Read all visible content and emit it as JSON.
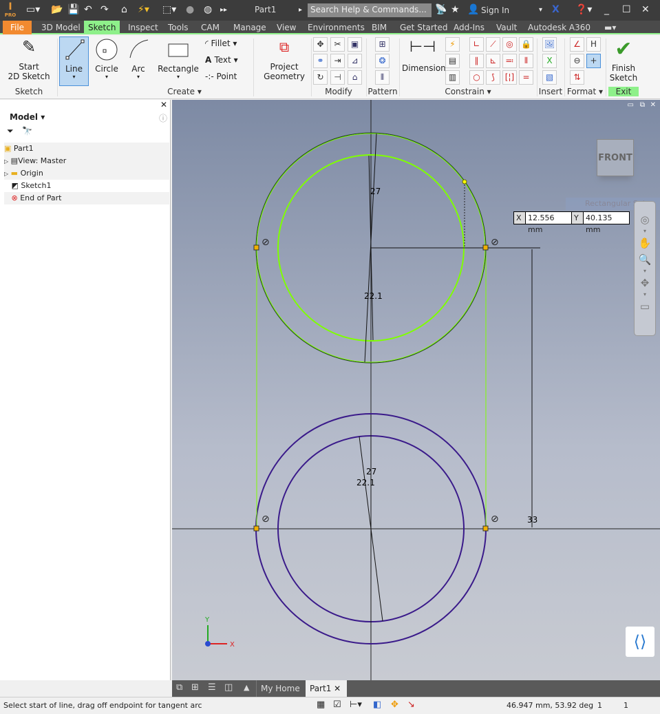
{
  "title_bar": {
    "doc_title": "Part1",
    "search_placeholder": "Search Help & Commands...",
    "sign_in": "Sign In",
    "app_badge": "PRO"
  },
  "menu": {
    "tabs": [
      "File",
      "3D Model",
      "Sketch",
      "Inspect",
      "Tools",
      "CAM",
      "Manage",
      "View",
      "Environments",
      "BIM",
      "Get Started",
      "Add-Ins",
      "Vault",
      "Autodesk A360"
    ],
    "active": "Sketch"
  },
  "ribbon": {
    "sketch": {
      "start_line1": "Start",
      "start_line2": "2D Sketch",
      "group": "Sketch"
    },
    "create": {
      "line": "Line",
      "circle": "Circle",
      "arc": "Arc",
      "rectangle": "Rectangle",
      "fillet": "Fillet",
      "text": "Text",
      "point": "Point",
      "project_line1": "Project",
      "project_line2": "Geometry",
      "group": "Create"
    },
    "modify": {
      "group": "Modify"
    },
    "pattern": {
      "group": "Pattern"
    },
    "constrain": {
      "dimension": "Dimension",
      "group": "Constrain"
    },
    "insert": {
      "group": "Insert"
    },
    "format": {
      "group": "Format"
    },
    "exit": {
      "finish_line1": "Finish",
      "finish_line2": "Sketch",
      "group": "Exit"
    },
    "accent": "#8ef08a"
  },
  "browser": {
    "title": "Model",
    "items": [
      {
        "label": "Part1",
        "icon": "part-icon"
      },
      {
        "label": "View: Master",
        "icon": "view-icon"
      },
      {
        "label": "Origin",
        "icon": "folder-icon"
      },
      {
        "label": "Sketch1",
        "icon": "sketch-icon"
      },
      {
        "label": "End of Part",
        "icon": "end-of-part-icon"
      }
    ]
  },
  "viewport": {
    "viewcube": "FRONT",
    "snip_label": "Rectangular Snip",
    "coord": {
      "x_label": "X",
      "x_value": "12.556 mm",
      "y_label": "Y",
      "y_value": "40.135 mm"
    },
    "dimensions": {
      "outer_top": "27",
      "inner_top": "22.1",
      "outer_bottom": "27",
      "inner_bottom": "22.1",
      "distance": "33"
    },
    "axis": {
      "x": "X",
      "y": "Y"
    },
    "colors": {
      "active_sketch": "#7fff00",
      "inactive_sketch": "#3a1a8a",
      "dimension": "#000000"
    }
  },
  "doc_tabs": {
    "home": "My Home",
    "part": "Part1"
  },
  "status": {
    "message": "Select start of line, drag off endpoint for tangent arc",
    "readout": "46.947 mm, 53.92 deg",
    "count1": "1",
    "count2": "1"
  }
}
